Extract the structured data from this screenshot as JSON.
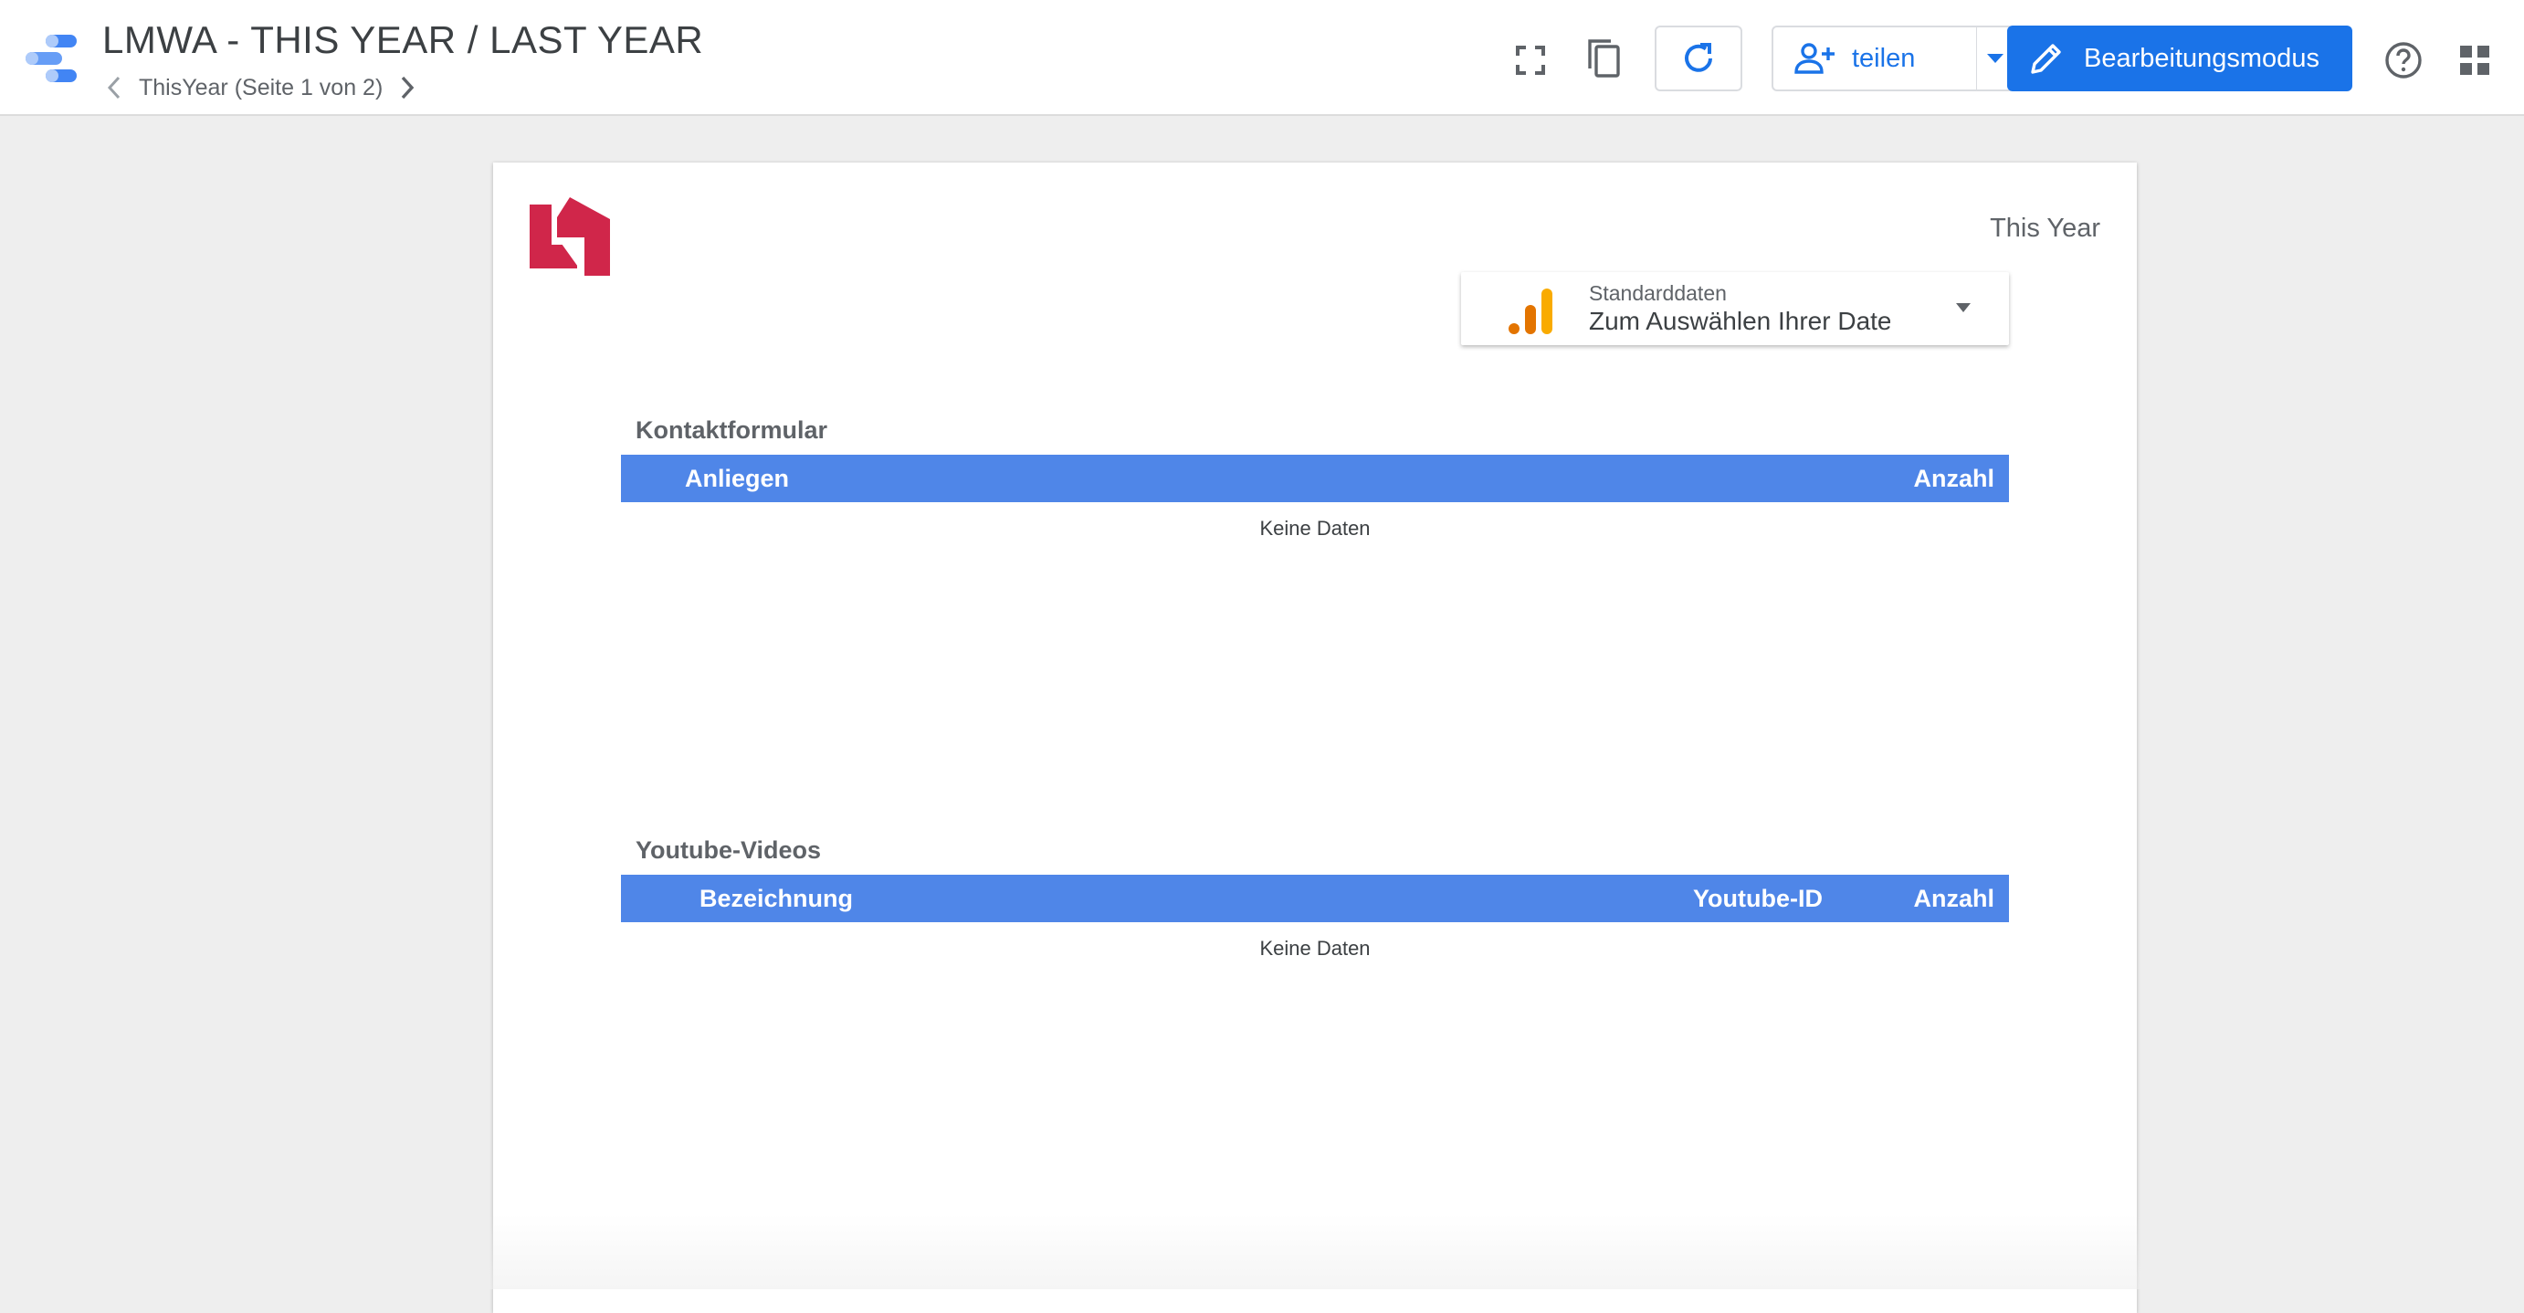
{
  "header": {
    "title": "LMWA - THIS YEAR / LAST YEAR",
    "page_indicator": "ThisYear (Seite 1 von 2)",
    "share_label": "teilen",
    "edit_mode_label": "Bearbeitungsmodus"
  },
  "icons": {
    "app_logo": "looker-studio-logo-icon",
    "fullscreen": "fullscreen-icon",
    "copy": "copy-icon",
    "refresh": "refresh-icon",
    "share": "person-add-icon",
    "share_menu": "caret-down-icon",
    "edit": "pencil-icon",
    "help": "help-icon",
    "apps": "apps-grid-icon",
    "data_source": "analytics-icon"
  },
  "colors": {
    "accent": "#1a73e8",
    "table_header": "#4f86e8",
    "brand": "#d0264a",
    "analytics_orange_dark": "#e37400",
    "analytics_orange_light": "#f9ab00"
  },
  "report": {
    "period_label": "This Year",
    "data_source": {
      "label": "Standarddaten",
      "value": "Zum Auswählen Ihrer Datenquelle"
    },
    "tables": [
      {
        "title": "Kontaktformular",
        "columns": [
          "Anliegen",
          "Anzahl"
        ],
        "empty_text": "Keine Daten"
      },
      {
        "title": "Youtube-Videos",
        "columns": [
          "Bezeichnung",
          "Youtube-ID",
          "Anzahl"
        ],
        "empty_text": "Keine Daten"
      }
    ]
  }
}
